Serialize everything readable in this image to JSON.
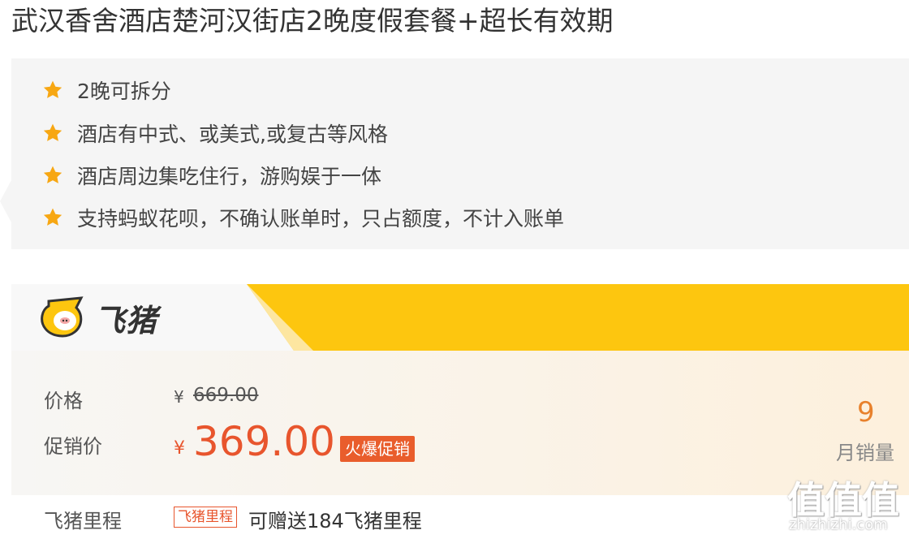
{
  "title": "武汉香舍酒店楚河汉街店2晚度假套餐+超长有效期",
  "features": [
    "2晚可拆分",
    "酒店有中式、或美式,或复古等风格",
    "酒店周边集吃住行，游购娱于一体",
    "支持蚂蚁花呗，不确认账单时，只占额度，不计入账单"
  ],
  "brand": {
    "name": "飞猪",
    "logo_icon": "fliggy-pig-icon",
    "accent": "#fcc000"
  },
  "price": {
    "label": "价格",
    "currency": "¥",
    "original": "669.00",
    "promo_label": "促销价",
    "promo_currency": "¥",
    "promo": "369.00",
    "promo_badge": "火爆促销",
    "promo_color": "#e8552d"
  },
  "sales": {
    "count": "9",
    "label": "月销量"
  },
  "mileage": {
    "label": "飞猪里程",
    "badge": "飞猪里程",
    "text": "可赠送184飞猪里程"
  },
  "watermark": {
    "glyphs": "值值值",
    "url": "zhizhizhi.com"
  }
}
